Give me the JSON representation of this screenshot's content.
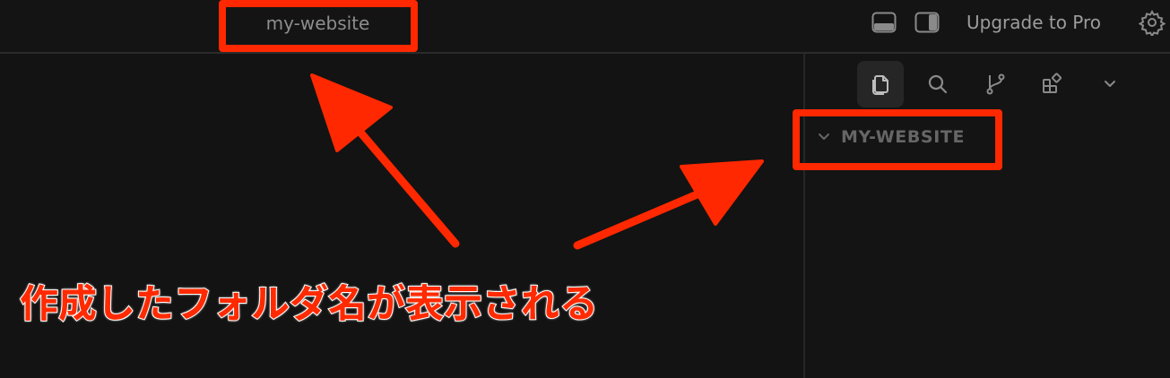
{
  "titlebar": {
    "project_name": "my-website",
    "upgrade_label": "Upgrade to Pro",
    "icons": [
      "layout-bottom-panel-icon",
      "layout-sidebar-right-icon",
      "settings-gear-icon"
    ]
  },
  "sidebar": {
    "tabs": [
      {
        "name": "files",
        "icon": "files-icon",
        "active": true
      },
      {
        "name": "search",
        "icon": "search-icon",
        "active": false
      },
      {
        "name": "source-control",
        "icon": "git-branch-icon",
        "active": false
      },
      {
        "name": "extensions",
        "icon": "extensions-icon",
        "active": false
      },
      {
        "name": "more",
        "icon": "chevron-down-icon",
        "active": false
      }
    ],
    "folder_name": "MY-WEBSITE"
  },
  "annotation": {
    "caption": "作成したフォルダ名が表示される",
    "highlight_color": "#ff2800"
  }
}
